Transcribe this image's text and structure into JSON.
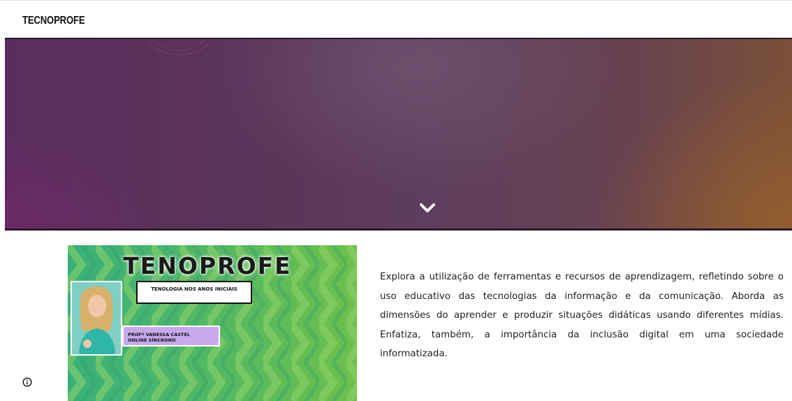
{
  "header": {
    "site_title": "TECNOPROFE"
  },
  "hero": {
    "scroll_icon": "chevron-down-icon"
  },
  "thumbnail": {
    "title": "TENOPROFE",
    "subtitle": "TENOLOGIA NOS ANOS INICIAIS",
    "teacher_line1": "PROFª VANESSA CASTEL",
    "teacher_line2": "ONLINE SÍNCRONO"
  },
  "main": {
    "description": "Explora a utilização de ferramentas e recursos de aprendizagem, refletindo sobre o uso educativo das tecnologias da informação e da comunicação. Aborda as dimensões do aprender e produzir situações didáticas usando diferentes mídias. Enfatiza, também, a importância da inclusão digital em uma sociedade informatizada."
  },
  "footer": {
    "info_icon": "info-icon"
  },
  "colors": {
    "hero_left": "#5a2d5e",
    "hero_right": "#7a5038",
    "thumbnail_green": "#3fae6f",
    "thumbnail_label_purple": "#c7a8ee"
  }
}
